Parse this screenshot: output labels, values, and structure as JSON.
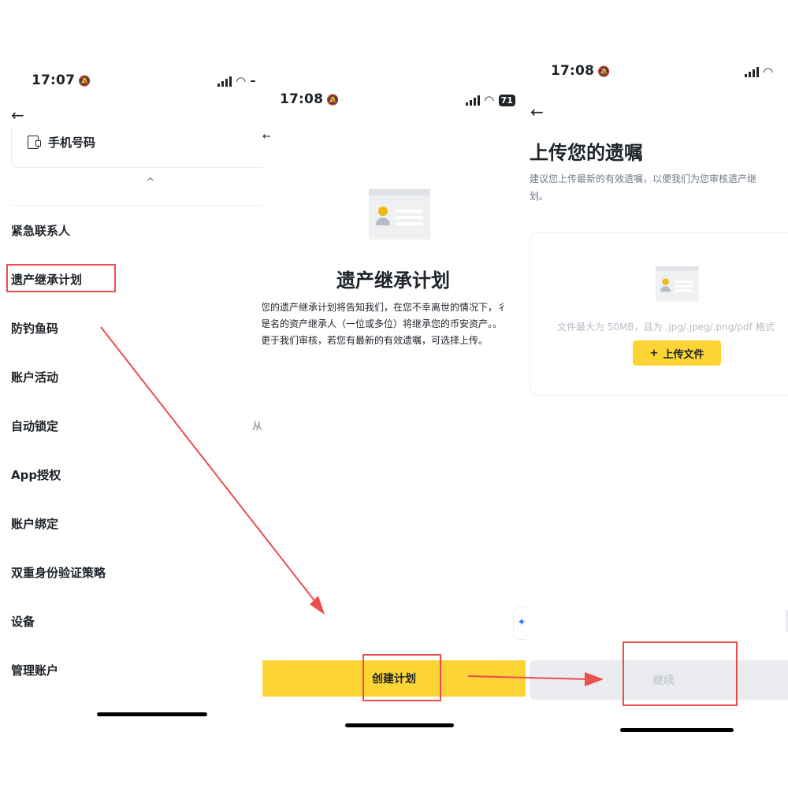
{
  "colors": {
    "accent": "#fcd535",
    "annotation": "#ec4d4d",
    "text": "#1e2329",
    "muted": "#707a8a",
    "disabled": "#b7bdc6"
  },
  "screen1": {
    "time": "17:07",
    "battery": "",
    "phone_label": "手机号码",
    "chevron": "^",
    "menu": [
      "紧急联系人",
      "遗产继承计划",
      "防钓鱼码",
      "账户活动",
      "自动锁定",
      "App授权",
      "账户绑定",
      "双重身份验证策略",
      "设备",
      "管理账户"
    ],
    "auto_lock_value": "从"
  },
  "screen2": {
    "time": "17:08",
    "battery": "71",
    "title": "遗产继承计划",
    "desc_lines": [
      "您的遗产继承计划将告知我们，在您不幸离世的情况下，",
      "是名的资产继承人（一位或多位）将继承您的币安资产。",
      "更于我们审核，若您有最新的有效遗嘱，可选择上传。"
    ],
    "desc_suffix": [
      "彳",
      "。",
      ""
    ],
    "button": "创建计划"
  },
  "screen3": {
    "time": "17:08",
    "title": "上传您的遗嘱",
    "sub_lines": [
      "建议您上传最新的有效遗嘱，以便我们为您审核遗产继",
      "划。"
    ],
    "hint": "文件最大为 50MB，且为 .jpg/.jpeg/.png/pdf 格式",
    "upload_button": "上传文件",
    "upload_plus": "+",
    "continue_button": "继续"
  }
}
